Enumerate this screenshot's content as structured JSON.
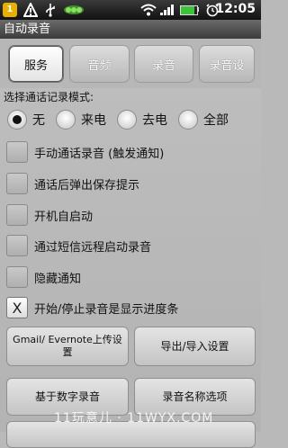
{
  "status_bar": {
    "time": "12:05",
    "icons": [
      "usb-icon",
      "warning-icon",
      "app-notification-icon",
      "wifi-icon",
      "signal-icon",
      "battery-icon",
      "alarm-icon"
    ],
    "notification_badge": "1",
    "battery_level": 0.85
  },
  "app": {
    "title": "自动录音"
  },
  "tabs": [
    {
      "label": "服务",
      "active": true
    },
    {
      "label": "音频",
      "active": false
    },
    {
      "label": "录音",
      "active": false
    },
    {
      "label": "录音设",
      "active": false
    }
  ],
  "mode": {
    "label": "选择通话记录模式:",
    "options": [
      {
        "label": "无",
        "checked": true
      },
      {
        "label": "来电",
        "checked": false
      },
      {
        "label": "去电",
        "checked": false
      },
      {
        "label": "全部",
        "checked": false
      }
    ]
  },
  "options": [
    {
      "label": "手动通话录音 (触发通知)",
      "checked": false
    },
    {
      "label": "通话后弹出保存提示",
      "checked": false
    },
    {
      "label": "开机自启动",
      "checked": false
    },
    {
      "label": "通过短信远程启动录音",
      "checked": false
    },
    {
      "label": "隐藏通知",
      "checked": false
    },
    {
      "label": "开始/停止录音是显示进度条",
      "checked": true,
      "mark": "X"
    }
  ],
  "buttons": {
    "gmail_evernote": "Gmail/ Evernote上传设置",
    "export_import": "导出/导入设置",
    "digit_record": "基于数字录音",
    "name_options": "录音名称选项"
  },
  "watermark": "11玩意儿 · 11WYX.COM"
}
